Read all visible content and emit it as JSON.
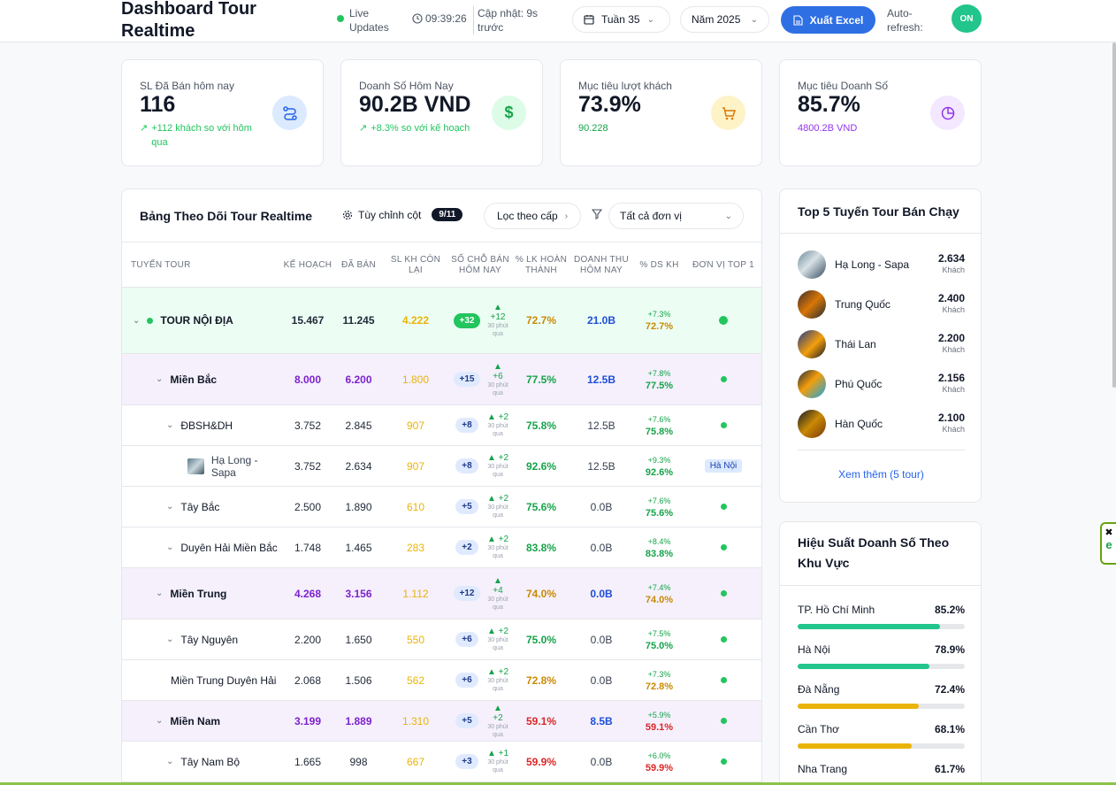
{
  "header": {
    "title": "Dashboard Tour Realtime",
    "live_label": "Live Updates",
    "time": "09:39:26",
    "updated": "Cập nhật: 9s trước",
    "week": "Tuần 35",
    "year": "Năm 2025",
    "export_label": "Xuất Excel",
    "auto_refresh_label": "Auto-refresh:",
    "toggle_label": "ON"
  },
  "kpis": [
    {
      "label": "SL Đã Bán hôm nay",
      "value": "116",
      "sub": "+112 khách so với hôm qua",
      "color": "#22c55e",
      "icon": "route-icon"
    },
    {
      "label": "Doanh Số Hôm Nay",
      "value": "90.2B VND",
      "sub": "+8.3% so với kế hoạch",
      "color": "#22c55e",
      "icon": "dollar-icon"
    },
    {
      "label": "Mục tiêu lượt khách",
      "value": "73.9%",
      "sub": "90.228",
      "color": "#16a34a",
      "icon": "cart-icon"
    },
    {
      "label": "Mục tiêu Doanh Số",
      "value": "85.7%",
      "sub": "4800.2B VND",
      "color": "#9333ea",
      "icon": "pie-icon"
    }
  ],
  "table": {
    "title": "Bảng Theo Dõi Tour Realtime",
    "customize_label": "Tùy chỉnh cột",
    "column_count": "9/11",
    "filter_label": "Lọc theo cấp",
    "unit_filter": "Tất cả đơn vị",
    "headers": [
      "TUYẾN TOUR",
      "KẾ HOẠCH",
      "ĐÃ BÁN",
      "SL KH CÒN LẠI",
      "SỐ CHỖ BÁN HÔM NAY",
      "% LK HOÀN THÀNH",
      "DOANH THU HÔM NAY",
      "% DS KH",
      "ĐƠN VỊ TOP 1"
    ],
    "increment_note": "30 phút qua",
    "rows": [
      {
        "name": "TOUR NỘI ĐỊA",
        "plan": "15.467",
        "sold": "11.245",
        "remain": "4.222",
        "today": "+32",
        "inc": "+12",
        "pct": "72.7%",
        "revenue": "21.0B",
        "ds_up": "+7.3%",
        "ds": "72.7%",
        "unit": ""
      },
      {
        "name": "Miền Bắc",
        "plan": "8.000",
        "sold": "6.200",
        "remain": "1.800",
        "today": "+15",
        "inc": "+6",
        "pct": "77.5%",
        "revenue": "12.5B",
        "ds_up": "+7.8%",
        "ds": "77.5%",
        "unit": ""
      },
      {
        "name": "ĐBSH&DH",
        "plan": "3.752",
        "sold": "2.845",
        "remain": "907",
        "today": "+8",
        "inc": "+2",
        "pct": "75.8%",
        "revenue": "12.5B",
        "ds_up": "+7.6%",
        "ds": "75.8%",
        "unit": ""
      },
      {
        "name": "Hạ Long - Sapa",
        "plan": "3.752",
        "sold": "2.634",
        "remain": "907",
        "today": "+8",
        "inc": "+2",
        "pct": "92.6%",
        "revenue": "12.5B",
        "ds_up": "+9.3%",
        "ds": "92.6%",
        "unit": "Hà Nội"
      },
      {
        "name": "Tây Bắc",
        "plan": "2.500",
        "sold": "1.890",
        "remain": "610",
        "today": "+5",
        "inc": "+2",
        "pct": "75.6%",
        "revenue": "0.0B",
        "ds_up": "+7.6%",
        "ds": "75.6%",
        "unit": ""
      },
      {
        "name": "Duyên Hải Miền Bắc",
        "plan": "1.748",
        "sold": "1.465",
        "remain": "283",
        "today": "+2",
        "inc": "+2",
        "pct": "83.8%",
        "revenue": "0.0B",
        "ds_up": "+8.4%",
        "ds": "83.8%",
        "unit": ""
      },
      {
        "name": "Miền Trung",
        "plan": "4.268",
        "sold": "3.156",
        "remain": "1.112",
        "today": "+12",
        "inc": "+4",
        "pct": "74.0%",
        "revenue": "0.0B",
        "ds_up": "+7.4%",
        "ds": "74.0%",
        "unit": ""
      },
      {
        "name": "Tây Nguyên",
        "plan": "2.200",
        "sold": "1.650",
        "remain": "550",
        "today": "+6",
        "inc": "+2",
        "pct": "75.0%",
        "revenue": "0.0B",
        "ds_up": "+7.5%",
        "ds": "75.0%",
        "unit": ""
      },
      {
        "name": "Miền Trung Duyên Hải",
        "plan": "2.068",
        "sold": "1.506",
        "remain": "562",
        "today": "+6",
        "inc": "+2",
        "pct": "72.8%",
        "revenue": "0.0B",
        "ds_up": "+7.3%",
        "ds": "72.8%",
        "unit": ""
      },
      {
        "name": "Miền Nam",
        "plan": "3.199",
        "sold": "1.889",
        "remain": "1.310",
        "today": "+5",
        "inc": "+2",
        "pct": "59.1%",
        "revenue": "8.5B",
        "ds_up": "+5.9%",
        "ds": "59.1%",
        "unit": ""
      },
      {
        "name": "Tây Nam Bộ",
        "plan": "1.665",
        "sold": "998",
        "remain": "667",
        "today": "+3",
        "inc": "+1",
        "pct": "59.9%",
        "revenue": "0.0B",
        "ds_up": "+6.0%",
        "ds": "59.9%",
        "unit": ""
      }
    ]
  },
  "top5": {
    "title": "Top 5 Tuyến Tour Bán Chạy",
    "unit": "Khách",
    "items": [
      {
        "name": "Hạ Long - Sapa",
        "value": "2.634"
      },
      {
        "name": "Trung Quốc",
        "value": "2.400"
      },
      {
        "name": "Thái Lan",
        "value": "2.200"
      },
      {
        "name": "Phú Quốc",
        "value": "2.156"
      },
      {
        "name": "Hàn Quốc",
        "value": "2.100"
      }
    ],
    "more": "Xem thêm (5 tour)"
  },
  "regions": {
    "title": "Hiệu Suất Doanh Số Theo Khu Vực",
    "items": [
      {
        "name": "TP. Hồ Chí Minh",
        "value": "85.2%",
        "fraction": 0.852,
        "color": "#22c58b"
      },
      {
        "name": "Hà Nội",
        "value": "78.9%",
        "fraction": 0.789,
        "color": "#22c58b"
      },
      {
        "name": "Đà Nẵng",
        "value": "72.4%",
        "fraction": 0.724,
        "color": "#eab308"
      },
      {
        "name": "Cần Thơ",
        "value": "68.1%",
        "fraction": 0.681,
        "color": "#eab308"
      },
      {
        "name": "Nha Trang",
        "value": "61.7%",
        "fraction": 0.617,
        "color": "#eab308"
      }
    ]
  }
}
